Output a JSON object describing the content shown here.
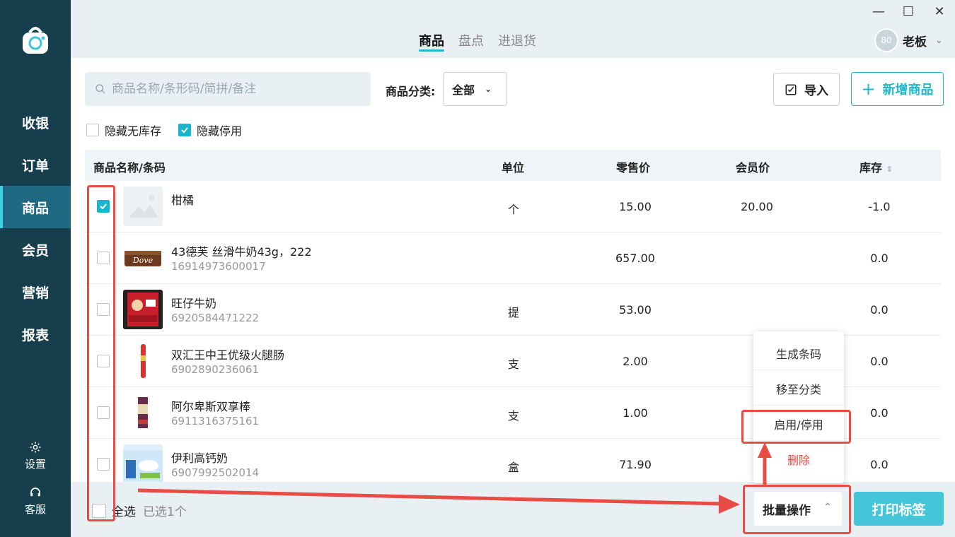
{
  "sidebar": {
    "items": [
      {
        "label": "收银"
      },
      {
        "label": "订单"
      },
      {
        "label": "商品"
      },
      {
        "label": "会员"
      },
      {
        "label": "营销"
      },
      {
        "label": "报表"
      }
    ],
    "settings_label": "设置",
    "service_label": "客服",
    "active_item": "商品"
  },
  "header": {
    "tabs": [
      {
        "label": "商品"
      },
      {
        "label": "盘点"
      },
      {
        "label": "进退货"
      }
    ],
    "active_tab": "商品",
    "user": {
      "avatar_text": "80",
      "name": "老板"
    }
  },
  "toolbar": {
    "search_placeholder": "商品名称/条形码/简拼/备注",
    "category_label": "商品分类:",
    "category_value": "全部",
    "import_label": "导入",
    "add_label": "新增商品"
  },
  "filters": [
    {
      "label": "隐藏无库存",
      "checked": false
    },
    {
      "label": "隐藏停用",
      "checked": true
    }
  ],
  "table": {
    "headers": {
      "name": "商品名称/条码",
      "unit": "单位",
      "retail_price": "零售价",
      "member_price": "会员价",
      "stock": "库存"
    },
    "rows": [
      {
        "name": "柑橘",
        "code": "",
        "unit": "个",
        "retail_price": "15.00",
        "member_price": "20.00",
        "stock": "-1.0",
        "checked": true
      },
      {
        "name": "43德芙 丝滑牛奶43g，222",
        "code": "16914973600017",
        "unit": "",
        "retail_price": "657.00",
        "member_price": "",
        "stock": "0.0",
        "checked": false
      },
      {
        "name": "旺仔牛奶",
        "code": "6920584471222",
        "unit": "提",
        "retail_price": "53.00",
        "member_price": "",
        "stock": "0.0",
        "checked": false
      },
      {
        "name": "双汇王中王优级火腿肠",
        "code": "6902890236061",
        "unit": "支",
        "retail_price": "2.00",
        "member_price": "",
        "stock": "0.0",
        "checked": false
      },
      {
        "name": "阿尔卑斯双享棒",
        "code": "6911316375161",
        "unit": "支",
        "retail_price": "1.00",
        "member_price": "",
        "stock": "0.0",
        "checked": false
      },
      {
        "name": "伊利高钙奶",
        "code": "6907992502014",
        "unit": "盒",
        "retail_price": "71.90",
        "member_price": "",
        "stock": "0.0",
        "checked": false
      }
    ]
  },
  "footer": {
    "select_all_label": "全选",
    "selected_count_text": "已选1个",
    "batch_label": "批量操作",
    "print_label": "打印标签"
  },
  "batch_menu": {
    "items": [
      {
        "label": "生成条码"
      },
      {
        "label": "移至分类"
      },
      {
        "label": "启用/停用"
      },
      {
        "label": "删除"
      }
    ]
  },
  "colors": {
    "sidebar_bg": "#163e4c",
    "accent": "#1fb8cc",
    "annotation": "#e94b45",
    "danger": "#e5483d"
  }
}
